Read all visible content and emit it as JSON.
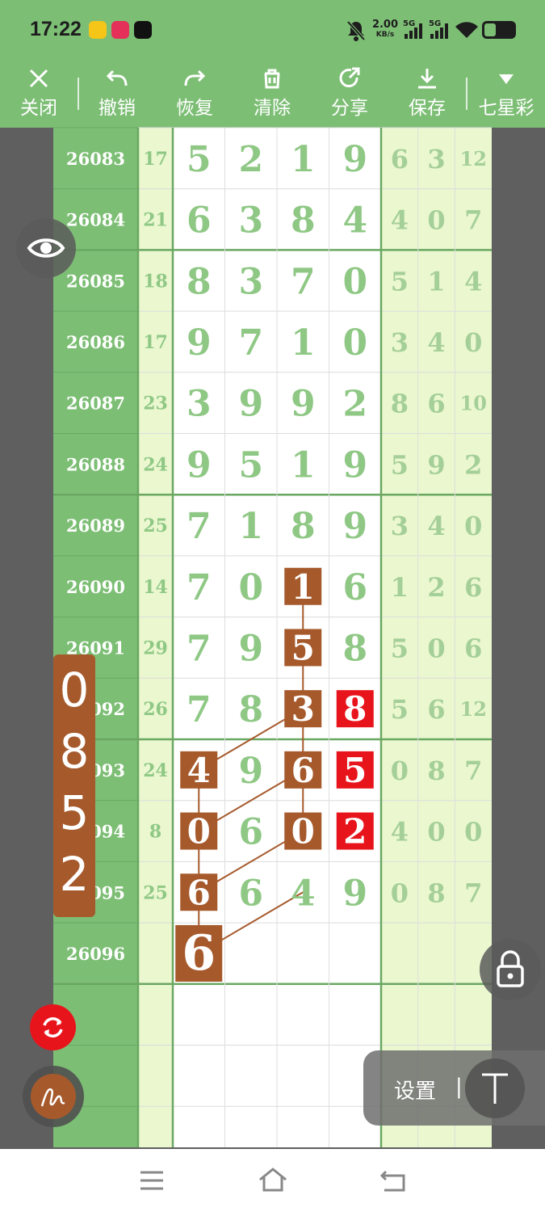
{
  "status": {
    "time": "17:22",
    "speed_value": "2.00",
    "speed_unit": "KB/s",
    "sig1": "5G",
    "sig2": "5G"
  },
  "toolbar": [
    {
      "label": "关闭",
      "icon": "close-icon"
    },
    {
      "label": "撤销",
      "icon": "undo-icon"
    },
    {
      "label": "恢复",
      "icon": "redo-icon"
    },
    {
      "label": "清除",
      "icon": "trash-icon"
    },
    {
      "label": "分享",
      "icon": "share-icon"
    },
    {
      "label": "保存",
      "icon": "download-icon"
    },
    {
      "label": "七星彩",
      "icon": "dropdown-triangle-icon"
    }
  ],
  "rows": [
    {
      "period": "26083",
      "sum": "17",
      "digits": [
        "5",
        "2",
        "1",
        "9"
      ],
      "extra": [
        "6",
        "3",
        "12"
      ]
    },
    {
      "period": "26084",
      "sum": "21",
      "digits": [
        "6",
        "3",
        "8",
        "4"
      ],
      "extra": [
        "4",
        "0",
        "7"
      ]
    },
    {
      "period": "26085",
      "sum": "18",
      "digits": [
        "8",
        "3",
        "7",
        "0"
      ],
      "extra": [
        "5",
        "1",
        "4"
      ]
    },
    {
      "period": "26086",
      "sum": "17",
      "digits": [
        "9",
        "7",
        "1",
        "0"
      ],
      "extra": [
        "3",
        "4",
        "0"
      ]
    },
    {
      "period": "26087",
      "sum": "23",
      "digits": [
        "3",
        "9",
        "9",
        "2"
      ],
      "extra": [
        "8",
        "6",
        "10"
      ]
    },
    {
      "period": "26088",
      "sum": "24",
      "digits": [
        "9",
        "5",
        "1",
        "9"
      ],
      "extra": [
        "5",
        "9",
        "2"
      ]
    },
    {
      "period": "26089",
      "sum": "25",
      "digits": [
        "7",
        "1",
        "8",
        "9"
      ],
      "extra": [
        "3",
        "4",
        "0"
      ]
    },
    {
      "period": "26090",
      "sum": "14",
      "digits": [
        "7",
        "0",
        "1",
        "6"
      ],
      "extra": [
        "1",
        "2",
        "6"
      ]
    },
    {
      "period": "26091",
      "sum": "29",
      "digits": [
        "7",
        "9",
        "5",
        "8"
      ],
      "extra": [
        "5",
        "0",
        "6"
      ]
    },
    {
      "period": "26092",
      "sum": "26",
      "digits": [
        "7",
        "8",
        "3",
        "8"
      ],
      "extra": [
        "5",
        "6",
        "12"
      ]
    },
    {
      "period": "26093",
      "sum": "24",
      "digits": [
        "4",
        "9",
        "6",
        "5"
      ],
      "extra": [
        "0",
        "8",
        "7"
      ]
    },
    {
      "period": "26094",
      "sum": "8",
      "digits": [
        "0",
        "6",
        "0",
        "2"
      ],
      "extra": [
        "4",
        "0",
        "0"
      ]
    },
    {
      "period": "26095",
      "sum": "25",
      "digits": [
        "6",
        "6",
        "4",
        "9"
      ],
      "extra": [
        "0",
        "8",
        "7"
      ]
    },
    {
      "period": "26096",
      "sum": "",
      "digits": [
        "6",
        "",
        "",
        ""
      ],
      "extra": [
        "",
        "",
        ""
      ]
    },
    {
      "period": "",
      "sum": "",
      "digits": [
        "",
        "",
        "",
        ""
      ],
      "extra": [
        "",
        "",
        ""
      ]
    },
    {
      "period": "",
      "sum": "",
      "digits": [
        "",
        "",
        "",
        ""
      ],
      "extra": [
        "",
        "",
        ""
      ]
    },
    {
      "period": "",
      "sum": "",
      "digits": [
        "",
        "",
        "",
        ""
      ],
      "extra": [
        "",
        "",
        ""
      ]
    }
  ],
  "highlights": {
    "brown": [
      [
        7,
        2
      ],
      [
        8,
        2
      ],
      [
        9,
        2
      ],
      [
        10,
        2
      ],
      [
        11,
        2
      ],
      [
        10,
        0
      ],
      [
        11,
        0
      ],
      [
        12,
        0
      ],
      [
        13,
        0
      ]
    ],
    "red": [
      [
        9,
        3
      ],
      [
        10,
        3
      ],
      [
        11,
        3
      ]
    ]
  },
  "colors": {
    "header_green": "#7dbe75",
    "brown": "#a65a2c",
    "red": "#e8141c",
    "digit_green": "#8fc885"
  },
  "side_panel": {
    "digits": [
      "0",
      "8",
      "5",
      "2"
    ]
  },
  "settings_panel": {
    "label": "设置",
    "separator": "|"
  },
  "buttons": {
    "eye": "eye-icon",
    "refresh": "refresh-icon",
    "brush": "pen-icon",
    "lock": "lock-icon",
    "text_tool": "text-tool-icon"
  },
  "navbar": {
    "menu": "menu-icon",
    "home": "home-icon",
    "back": "back-icon"
  }
}
